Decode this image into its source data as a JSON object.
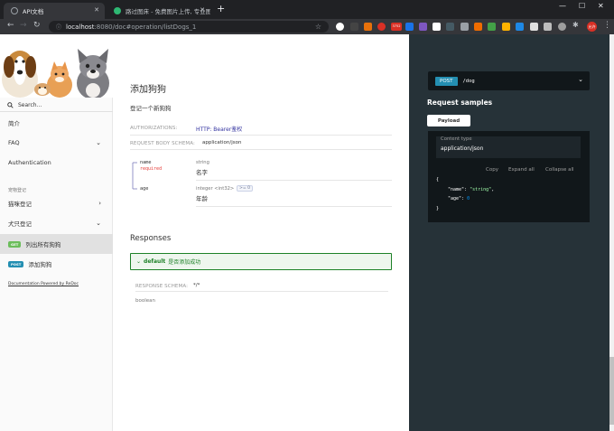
{
  "browser": {
    "tabs": [
      {
        "title": "API文档"
      },
      {
        "title": "路过图床 - 免费图片上传, 专业图"
      }
    ],
    "address": {
      "host": "localhost",
      "rest": ":8080/doc#operation/listDogs_1"
    },
    "profile": "允许",
    "ext_badge": "3752"
  },
  "sidebar": {
    "search_placeholder": "Search...",
    "items": [
      {
        "label": "简介"
      },
      {
        "label": "FAQ"
      },
      {
        "label": "Authentication"
      }
    ],
    "group_label": "宠物登记",
    "groups": [
      {
        "label": "猫咪登记"
      },
      {
        "label": "犬只登记"
      }
    ],
    "operations": [
      {
        "method": "GET",
        "label": "列出所有狗狗"
      },
      {
        "method": "POST",
        "label": "添加狗狗"
      }
    ],
    "powered": "Documentation Powered by ReDoc"
  },
  "operation": {
    "title": "添加狗狗",
    "description": "登记一个新狗狗",
    "authorizations_label": "AUTHORIZATIONS:",
    "authorizations_value": "HTTP: Bearer鉴权",
    "request_schema_label": "REQUEST BODY SCHEMA:",
    "request_schema_value": "application/json",
    "properties": [
      {
        "name": "name",
        "required": "required",
        "type": "string",
        "desc": "名字"
      },
      {
        "name": "age",
        "type": "integer <int32>",
        "constraint": ">= 0",
        "desc": "年龄"
      }
    ],
    "responses_title": "Responses",
    "response": {
      "code": "default",
      "desc": "是否添加成功"
    },
    "response_schema_label": "RESPONSE SCHEMA:",
    "response_schema_value": "*/*",
    "response_type": "boolean"
  },
  "samples": {
    "method": "POST",
    "path": "/dog",
    "title": "Request samples",
    "tab": "Payload",
    "content_type_label": "Content type",
    "content_type_value": "application/json",
    "copy": "Copy",
    "expand_all": "Expand all",
    "collapse_all": "Collapse all",
    "json_open": "{",
    "json_name_key": "\"name\"",
    "json_name_val": "\"string\"",
    "json_age_key": "\"age\"",
    "json_age_val": "0",
    "json_close": "}"
  }
}
